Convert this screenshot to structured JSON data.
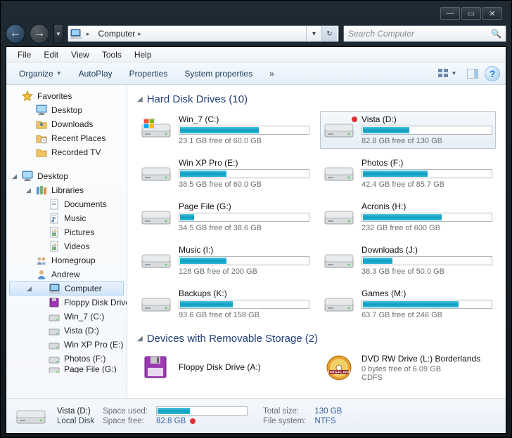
{
  "titlebar": {
    "min": "—",
    "max": "▭",
    "close": "✕"
  },
  "nav": {
    "back_icon": "←",
    "fwd_icon": "→",
    "drop_icon": "▼",
    "refresh_icon": "↻",
    "crumb_root": "▸",
    "crumb_computer": "Computer",
    "crumb_chev": "▸",
    "addr_drop": "▾"
  },
  "search": {
    "placeholder": "Search Computer",
    "icon": "🔍"
  },
  "menubar": [
    "File",
    "Edit",
    "View",
    "Tools",
    "Help"
  ],
  "cmdbar": {
    "organize": "Organize",
    "autoplay": "AutoPlay",
    "properties": "Properties",
    "sysprops": "System properties",
    "overflow": "»",
    "help": "?"
  },
  "navpane": {
    "favorites": {
      "label": "Favorites",
      "items": [
        {
          "label": "Desktop",
          "icon": "desktop"
        },
        {
          "label": "Downloads",
          "icon": "downloads"
        },
        {
          "label": "Recent Places",
          "icon": "recent"
        },
        {
          "label": "Recorded TV",
          "icon": "folder"
        }
      ]
    },
    "desktop": {
      "label": "Desktop",
      "items": [
        {
          "label": "Libraries",
          "icon": "libraries",
          "children": [
            {
              "label": "Documents",
              "icon": "doc"
            },
            {
              "label": "Music",
              "icon": "music"
            },
            {
              "label": "Pictures",
              "icon": "pic"
            },
            {
              "label": "Videos",
              "icon": "vid"
            }
          ]
        },
        {
          "label": "Homegroup",
          "icon": "homegroup"
        },
        {
          "label": "Andrew",
          "icon": "user"
        },
        {
          "label": "Computer",
          "icon": "computer",
          "selected": true,
          "children": [
            {
              "label": "Floppy Disk Drive",
              "icon": "floppy"
            },
            {
              "label": "Win_7 (C:)",
              "icon": "hdd"
            },
            {
              "label": "Vista (D:)",
              "icon": "hdd"
            },
            {
              "label": "Win XP Pro (E:)",
              "icon": "hdd"
            },
            {
              "label": "Photos (F:)",
              "icon": "hdd"
            },
            {
              "label": "Page File (G:)",
              "icon": "hdd",
              "cut": true
            }
          ]
        }
      ]
    }
  },
  "main": {
    "group1": {
      "title": "Hard Disk Drives (10)",
      "drives": [
        {
          "name": "Win_7 (C:)",
          "free": "23.1 GB free of 60.0 GB",
          "pct": 61,
          "icon": "win"
        },
        {
          "name": "Vista (D:)",
          "free": "82.8 GB free of 130 GB",
          "pct": 36,
          "sel": true,
          "dot": true
        },
        {
          "name": "Win XP Pro (E:)",
          "free": "38.5 GB free of 60.0 GB",
          "pct": 36
        },
        {
          "name": "Photos (F:)",
          "free": "42.4 GB free of 85.7 GB",
          "pct": 50
        },
        {
          "name": "Page File (G:)",
          "free": "34.5 GB free of 38.6 GB",
          "pct": 11
        },
        {
          "name": "Acronis (H:)",
          "free": "232 GB free of 600 GB",
          "pct": 61
        },
        {
          "name": "Music (I:)",
          "free": "128 GB free of 200 GB",
          "pct": 36
        },
        {
          "name": "Downloads (J:)",
          "free": "38.3 GB free of 50.0 GB",
          "pct": 23
        },
        {
          "name": "Backups (K:)",
          "free": "93.6 GB free of 158 GB",
          "pct": 41
        },
        {
          "name": "Games (M:)",
          "free": "63.7 GB free of 246 GB",
          "pct": 74
        }
      ]
    },
    "group2": {
      "title": "Devices with Removable Storage (2)",
      "devices": [
        {
          "name": "Floppy Disk Drive (A:)",
          "icon": "floppybig"
        },
        {
          "name": "DVD RW Drive (L:) Borderlands",
          "sub1": "0 bytes free of 6.09 GB",
          "sub2": "CDFS",
          "icon": "dvd"
        }
      ]
    }
  },
  "details": {
    "name": "Vista (D:)",
    "type": "Local Disk",
    "used_label": "Space used:",
    "free_label": "Space free:",
    "free_val": "82.8 GB",
    "total_label": "Total size:",
    "total_val": "130 GB",
    "fs_label": "File system:",
    "fs_val": "NTFS"
  },
  "icons": {
    "star": "★",
    "tri_down": "▾",
    "tri_right": "▸"
  }
}
